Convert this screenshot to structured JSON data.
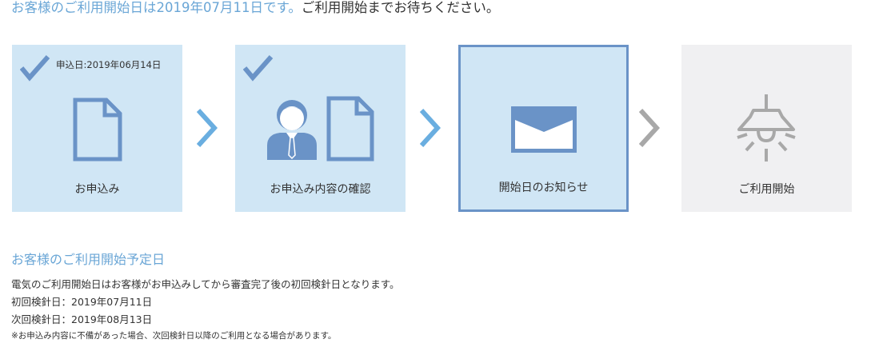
{
  "headline": {
    "accent": "お客様のご利用開始日は2019年07月11日です。",
    "rest": "ご利用開始までお待ちください。"
  },
  "steps": [
    {
      "label": "お申込み",
      "status": "done",
      "date": "申込日:2019年06月14日",
      "icon": "document-icon"
    },
    {
      "label": "お申込み内容の確認",
      "status": "done",
      "icon": "person-document-icon"
    },
    {
      "label": "開始日のお知らせ",
      "status": "current",
      "icon": "envelope-icon"
    },
    {
      "label": "ご利用開始",
      "status": "future",
      "icon": "lightbulb-icon"
    }
  ],
  "colors": {
    "accent": "#6aa6d6",
    "done_bg": "#d0e6f5",
    "current_border": "#6a93c7",
    "future_bg": "#f0f0f2",
    "icon_blue": "#6a93c7",
    "arrow_blue": "#6aaee0",
    "arrow_gray": "#a8a8a8"
  },
  "section": {
    "title": "お客様のご利用開始予定日",
    "description": "電気のご利用開始日はお客様がお申込みしてから審査完了後の初回検針日となります。",
    "first_reading": "初回検針日：2019年07月11日",
    "next_reading": "次回検針日：2019年08月13日",
    "note": "※お申込み内容に不備があった場合、次回検針日以降のご利用となる場合があります。"
  }
}
